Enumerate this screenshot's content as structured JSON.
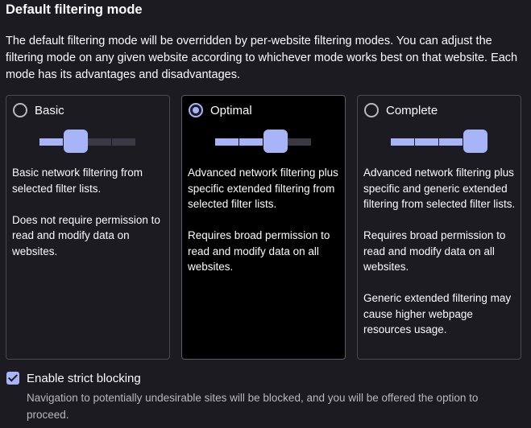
{
  "section": {
    "title": "Default filtering mode",
    "description": "The default filtering mode will be overridden by per-website filtering modes. You can adjust the filtering mode on any given website according to whichever mode works best on that website. Each mode has its advantages and disadvantages."
  },
  "modes": [
    {
      "label": "Basic",
      "selected": false,
      "level": 2,
      "paragraphs": [
        "Basic network filtering from selected filter lists.",
        "Does not require permission to read and modify data on websites."
      ]
    },
    {
      "label": "Optimal",
      "selected": true,
      "level": 3,
      "paragraphs": [
        "Advanced network filtering plus specific extended filtering from selected filter lists.",
        "Requires broad permission to read and modify data on all websites."
      ]
    },
    {
      "label": "Complete",
      "selected": false,
      "level": 4,
      "paragraphs": [
        "Advanced network filtering plus specific and generic extended filtering from selected filter lists.",
        "Requires broad permission to read and modify data on all websites.",
        "Generic extended filtering may cause higher webpage resources usage."
      ]
    }
  ],
  "strict_blocking": {
    "label": "Enable strict blocking",
    "checked": true,
    "description": "Navigation to potentially undesirable sites will be blocked, and you will be offered the option to proceed."
  },
  "colors": {
    "accent": "#a8b4f8",
    "background": "#1c1b22",
    "selected_card": "#000000"
  }
}
